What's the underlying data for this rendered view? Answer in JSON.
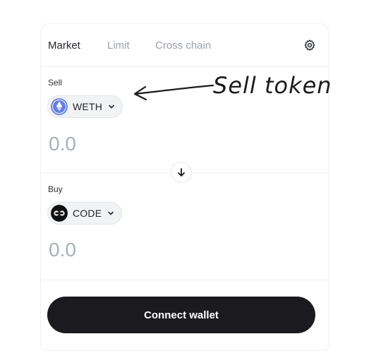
{
  "tabs": [
    {
      "label": "Market",
      "active": true
    },
    {
      "label": "Limit",
      "active": false
    },
    {
      "label": "Cross chain",
      "active": false
    }
  ],
  "settings_icon": "gear-icon",
  "sell": {
    "label": "Sell",
    "token": {
      "symbol": "WETH",
      "icon": "ethereum-logo-icon"
    },
    "amount_placeholder": "0.0"
  },
  "buy": {
    "label": "Buy",
    "token": {
      "symbol": "CODE",
      "icon": "code-token-logo-icon"
    },
    "amount_placeholder": "0.0"
  },
  "swap_icon": "arrow-down-icon",
  "connect_button": "Connect wallet",
  "annotation": {
    "text": "Sell token",
    "arrow_icon": "arrow-left-icon"
  },
  "colors": {
    "button_bg": "#1b1b1f",
    "placeholder": "#a7b0bc",
    "eth_blue": "#627eea"
  }
}
